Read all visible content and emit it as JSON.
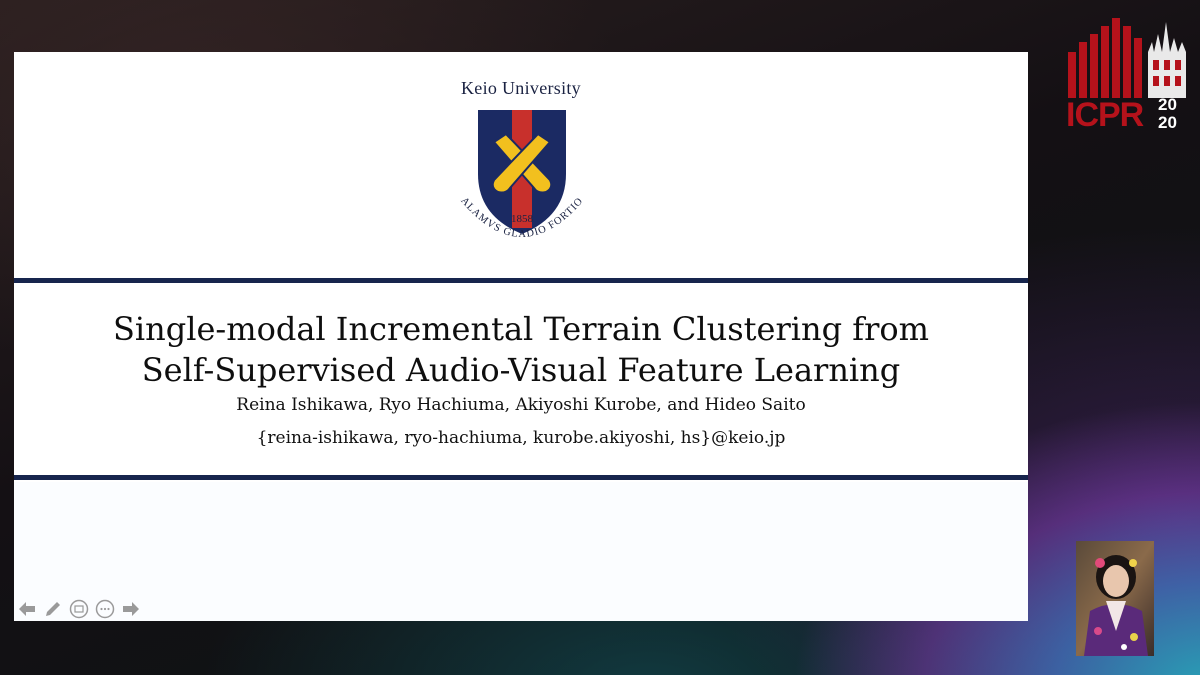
{
  "slide": {
    "university_name": "Keio University",
    "crest_year": "1858",
    "crest_motto": "CALAMVS GLADIO FORTIOR",
    "title_line1": "Single-modal Incremental Terrain Clustering from",
    "title_line2": "Self-Supervised Audio-Visual Feature Learning",
    "authors": "Reina Ishikawa, Ryo Hachiuma, Akiyoshi Kurobe, and Hideo Saito",
    "emails": "{reina-ishikawa, ryo-hachiuma, kurobe.akiyoshi, hs}@keio.jp",
    "rule_color": "#17254d"
  },
  "toolbar": {
    "icons": [
      "previous-arrow-icon",
      "pen-icon",
      "slide-grid-icon",
      "more-options-icon",
      "next-arrow-icon"
    ]
  },
  "conference_logo": {
    "text": "ICPR",
    "year_top": "20",
    "year_bottom": "20",
    "brand_color": "#b5121b"
  },
  "speaker_video": {
    "icon": "speaker-video-thumbnail"
  }
}
